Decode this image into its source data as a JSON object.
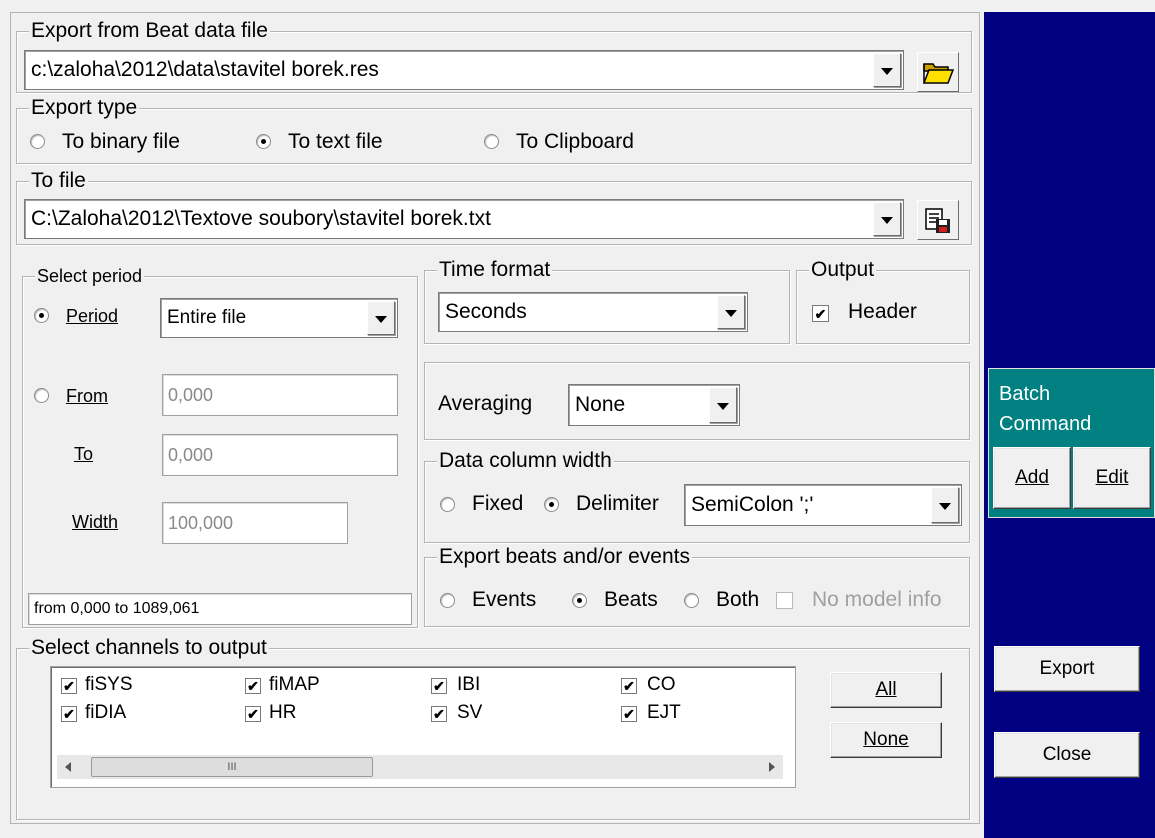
{
  "export_from": {
    "legend": "Export from Beat data file",
    "path": "c:\\zaloha\\2012\\data\\stavitel borek.res",
    "browse_icon": "folder-open-icon"
  },
  "export_type": {
    "legend": "Export type",
    "options": [
      "To binary file",
      "To text file",
      "To Clipboard"
    ],
    "selected": "To text file"
  },
  "to_file": {
    "legend": "To file",
    "path": "C:\\Zaloha\\2012\\Textove soubory\\stavitel borek.txt",
    "save_icon": "save-file-icon"
  },
  "select_period": {
    "legend": "Select period",
    "period_label": "Period",
    "period_value": "Entire file",
    "from_label": "From",
    "from_value": "0,000",
    "to_label": "To",
    "to_value": "0,000",
    "width_label": "Width",
    "width_value": "100,000",
    "summary": "from 0,000 to 1089,061"
  },
  "time_format": {
    "legend": "Time format",
    "value": "Seconds"
  },
  "output": {
    "legend": "Output",
    "header_label": "Header",
    "header_checked": true
  },
  "averaging": {
    "label": "Averaging",
    "value": "None"
  },
  "data_column_width": {
    "legend": "Data column width",
    "fixed_label": "Fixed",
    "delimiter_label": "Delimiter",
    "selected": "Delimiter",
    "delimiter_value": "SemiColon ';'"
  },
  "export_beats_events": {
    "legend": "Export beats and/or events",
    "events_label": "Events",
    "beats_label": "Beats",
    "both_label": "Both",
    "selected": "Beats",
    "no_model_info_label": "No model info"
  },
  "channels": {
    "legend": "Select channels to output",
    "items": [
      "fiSYS",
      "fiMAP",
      "IBI",
      "CO",
      "fiDIA",
      "HR",
      "SV",
      "EJT"
    ],
    "scroll_thumb_grip": "III",
    "all_label": "All",
    "none_label": "None"
  },
  "batch": {
    "title_line1": "Batch",
    "title_line2": "Command",
    "add_label": "Add",
    "edit_label": "Edit"
  },
  "actions": {
    "export_label": "Export",
    "close_label": "Close"
  },
  "colors": {
    "side_panel": "#000080",
    "batch_header": "#008080",
    "dialog_bg": "#f0f0f0"
  }
}
